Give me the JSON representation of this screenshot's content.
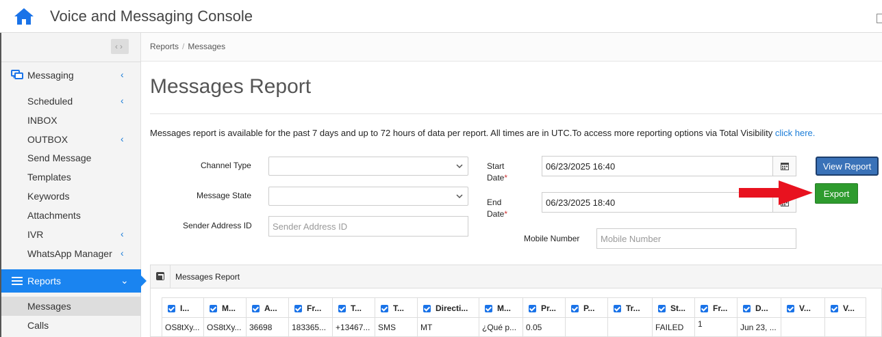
{
  "app": {
    "title": "Voice and Messaging Console"
  },
  "breadcrumb": {
    "items": [
      "Reports",
      "Messages"
    ]
  },
  "sidebar": {
    "messaging_label": "Messaging",
    "items": [
      "Scheduled",
      "INBOX",
      "OUTBOX",
      "Send Message",
      "Templates",
      "Keywords",
      "Attachments",
      "IVR",
      "WhatsApp Manager"
    ],
    "reports_label": "Reports",
    "report_items": [
      "Messages",
      "Calls"
    ]
  },
  "page": {
    "title": "Messages Report",
    "notice": "Messages report is available for the past 7 days and up to 72 hours of data per report. All times are in UTC.To access more reporting options via Total Visibility ",
    "notice_link": "click here."
  },
  "form": {
    "channel_type_label": "Channel Type",
    "message_state_label": "Message State",
    "sender_address_label": "Sender Address ID",
    "sender_address_placeholder": "Sender Address ID",
    "start_date_label_1": "Start",
    "start_date_label_2": "Date",
    "start_date_value": "06/23/2025 16:40",
    "end_date_label_1": "End",
    "end_date_label_2": "Date",
    "end_date_value": "06/23/2025 18:40",
    "mobile_number_label": "Mobile Number",
    "mobile_number_placeholder": "Mobile Number",
    "required_mark": "*"
  },
  "buttons": {
    "view_report": "View Report",
    "export": "Export"
  },
  "panel": {
    "title": "Messages Report"
  },
  "table": {
    "headers": [
      "I...",
      "M...",
      "A...",
      "Fr...",
      "T...",
      "T...",
      "Directi...",
      "M...",
      "Pr...",
      "P...",
      "Tr...",
      "St...",
      "Fr...",
      "D...",
      "V...",
      "V..."
    ],
    "row": [
      "OS8tXy...",
      "OS8tXy...",
      "36698",
      "183365...",
      "+13467...",
      "SMS",
      "MT",
      "¿Qué p...",
      "0.05",
      "",
      "",
      "FAILED",
      "1",
      "Jun 23, ...",
      "",
      ""
    ]
  },
  "colors": {
    "accent": "#1a84f0",
    "export_green": "#2e9b2e",
    "view_blue": "#3a72b8",
    "annotation_red": "#e8121f"
  }
}
